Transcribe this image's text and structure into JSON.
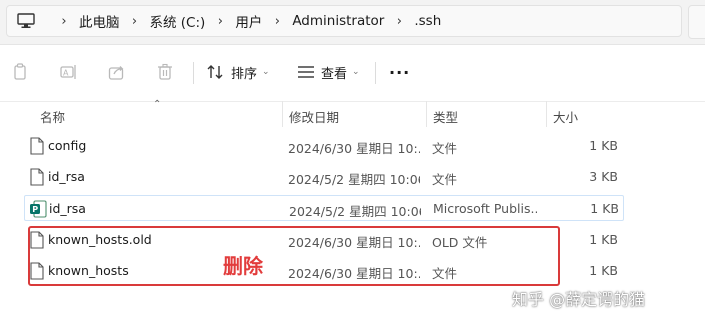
{
  "address_bar": {
    "icon": "pc-icon",
    "crumbs": [
      "此电脑",
      "系统 (C:)",
      "用户",
      "Administrator",
      ".ssh"
    ]
  },
  "toolbar": {
    "sort_label": "排序",
    "view_label": "查看",
    "more_label": "···"
  },
  "columns": {
    "name": "名称",
    "date": "修改日期",
    "type": "类型",
    "size": "大小"
  },
  "files": [
    {
      "name": "config",
      "date": "2024/6/30 星期日 10:...",
      "type": "文件",
      "size": "1 KB",
      "icon": "file-icon"
    },
    {
      "name": "id_rsa",
      "date": "2024/5/2 星期四 10:06",
      "type": "文件",
      "size": "3 KB",
      "icon": "file-icon"
    },
    {
      "name": "id_rsa",
      "date": "2024/5/2 星期四 10:06",
      "type": "Microsoft Publis...",
      "size": "1 KB",
      "icon": "publisher-icon",
      "selected": true
    },
    {
      "name": "known_hosts.old",
      "date": "2024/6/30 星期日 10:...",
      "type": "OLD 文件",
      "size": "1 KB",
      "icon": "file-icon"
    },
    {
      "name": "known_hosts",
      "date": "2024/6/30 星期日 10:...",
      "type": "文件",
      "size": "1 KB",
      "icon": "file-icon"
    }
  ],
  "annotation": {
    "label": "删除",
    "color": "#e23c3c"
  },
  "watermark": "知乎 @薛定谔的猫"
}
